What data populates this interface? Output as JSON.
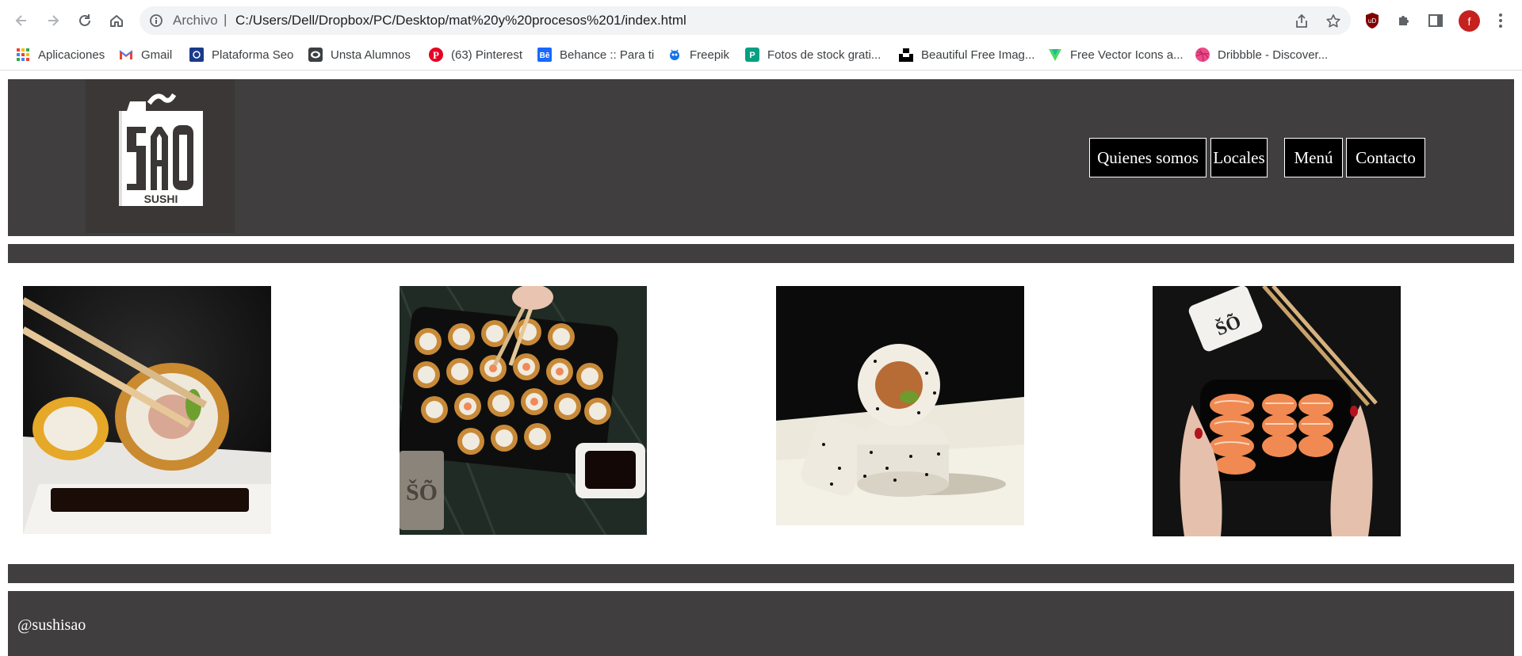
{
  "browser": {
    "address": {
      "scheme_label": "Archivo",
      "url": "C:/Users/Dell/Dropbox/PC/Desktop/mat%20y%20procesos%201/index.html"
    },
    "profile_initial": "f",
    "bookmarks": [
      {
        "label": "Aplicaciones",
        "icon": "apps-grid-icon"
      },
      {
        "label": "Gmail",
        "icon": "gmail-icon"
      },
      {
        "label": "Plataforma Seo",
        "icon": "seo-icon"
      },
      {
        "label": "Unsta Alumnos",
        "icon": "unsta-icon"
      },
      {
        "label": "(63) Pinterest",
        "icon": "pinterest-icon"
      },
      {
        "label": "Behance :: Para ti",
        "icon": "behance-icon"
      },
      {
        "label": "Freepik",
        "icon": "freepik-icon"
      },
      {
        "label": "Fotos de stock grati...",
        "icon": "stock-photos-icon"
      },
      {
        "label": "Beautiful Free Imag...",
        "icon": "unsplash-icon"
      },
      {
        "label": "Free Vector Icons a...",
        "icon": "vector-icons-icon"
      },
      {
        "label": "Dribbble - Discover...",
        "icon": "dribbble-icon"
      }
    ]
  },
  "site": {
    "logo": {
      "word": "SÃO",
      "sub": "SUSHI"
    },
    "nav": [
      "Quienes somos",
      "Locales",
      "Menú",
      "Contacto"
    ],
    "gallery": [
      {
        "subject": "chopsticks holding fried sushi roll over soy sauce"
      },
      {
        "subject": "tray of fried sushi rolls with soy sauce"
      },
      {
        "subject": "two sesame sushi rolls"
      },
      {
        "subject": "hands holding salmon sushi box"
      }
    ],
    "footer": {
      "handle": "@sushisao"
    }
  },
  "colors": {
    "header_bg": "#403e3f",
    "logo_bg": "#3a3736",
    "nav_border": "#ffffff",
    "nav_text": "#ffffff"
  }
}
